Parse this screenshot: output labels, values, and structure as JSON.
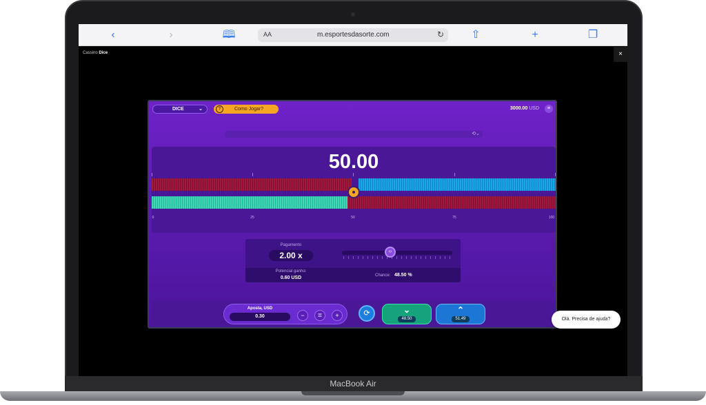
{
  "device": {
    "brand_label": "MacBook Air"
  },
  "browser": {
    "text_size_label": "AA",
    "url": "m.esportesdasorte.com",
    "icons": [
      "back-icon",
      "forward-icon",
      "bookmarks-icon",
      "lock-icon",
      "reload-icon",
      "share-icon",
      "new-tab-icon",
      "tabs-icon"
    ]
  },
  "page_header": {
    "crumb_prefix": "Cassino",
    "crumb_current": "Dice",
    "close_label": "×"
  },
  "game": {
    "game_selector": "DICE",
    "how_to_play": "Como Jogar?",
    "balance_value": "3000.00",
    "balance_currency": "USD",
    "roll_target": "50.00",
    "scale_labels": [
      "0",
      "25",
      "50",
      "75",
      "100"
    ],
    "multiplier_label": "Pagamento",
    "multiplier_value": "2.00 x",
    "potential_win_label": "Potencial ganho:",
    "potential_win_value": "0.60 USD",
    "chance_label": "Chance:",
    "chance_value": "48.50 %",
    "slider_position_fraction": 0.5,
    "bet_label": "Aposta, USD",
    "bet_value": "0.30",
    "under_value": "48.50",
    "over_value": "51.49",
    "colors": {
      "under": "#14a37a",
      "over": "#1c76d6",
      "accent": "#f5a623",
      "background": "#6f22c8"
    }
  },
  "chat": {
    "prompt": "Olá. Precisa de ajuda?"
  }
}
